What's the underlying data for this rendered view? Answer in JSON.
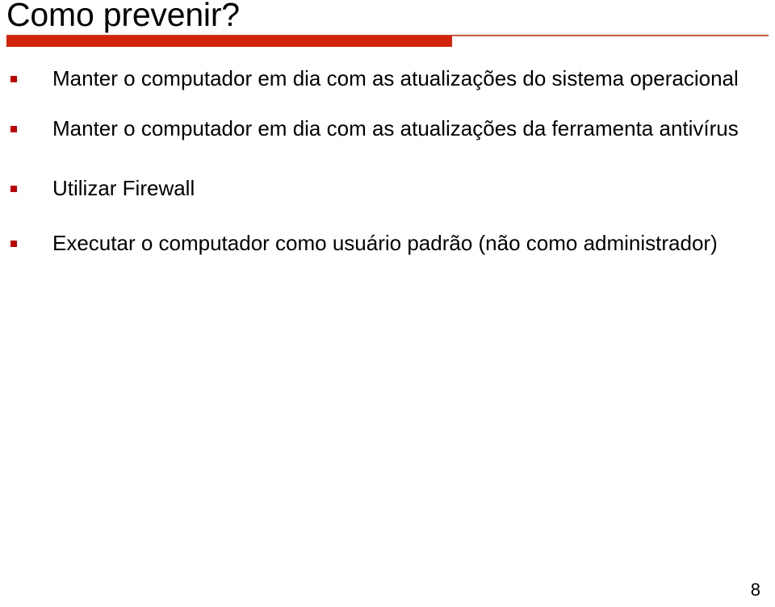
{
  "slide": {
    "title": "Como prevenir?",
    "page_number": "8",
    "accent_color": "#D2230C",
    "rule_color": "#C65A3C",
    "bullet_color": "#C00000",
    "text_color": "#000000",
    "background_color": "#FFFFFF"
  },
  "bullets": [
    {
      "marker": "square-bullet-icon",
      "text": "Manter o computador em dia com as atualizações do sistema operacional"
    },
    {
      "marker": "square-bullet-icon",
      "text": "Manter o computador em dia com as atualizações da ferramenta antivírus"
    },
    {
      "marker": "square-bullet-icon",
      "text": "Utilizar Firewall"
    },
    {
      "marker": "square-bullet-icon",
      "text": "Executar o computador como usuário padrão (não como administrador)"
    }
  ]
}
